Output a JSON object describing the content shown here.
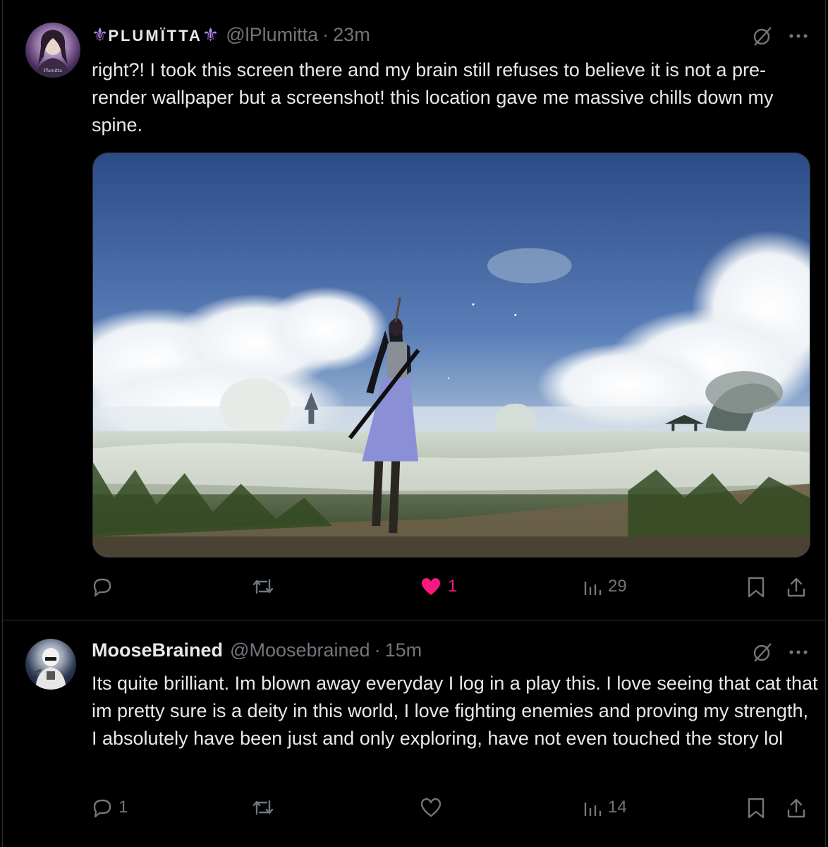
{
  "tweets": [
    {
      "display_name": "PLUMÏTTA",
      "name_decoration": "⚜",
      "handle": "@lPlumitta",
      "separator": "·",
      "time": "23m",
      "text": "right?! I took this screen there and my brain still refuses to believe it is not a pre-render wallpaper but a screenshot! this location gave me massive chills down my spine.",
      "avatar_icon": "profile-avatar",
      "has_media": true,
      "media_description_icon": "game-screenshot-image",
      "actions": {
        "reply_count": "",
        "retweet_count": "",
        "like_count": "1",
        "liked": true,
        "views_count": "29"
      }
    },
    {
      "display_name": "MooseBrained",
      "handle": "@Moosebrained",
      "separator": "·",
      "time": "15m",
      "text": "Its quite brilliant. Im blown away everyday I log in a play this. I love seeing that cat that im pretty sure is a deity in this world, I love fighting enemies and proving my strength, I absolutely have been just and only exploring, have not even touched the story lol",
      "avatar_icon": "profile-avatar",
      "has_media": false,
      "actions": {
        "reply_count": "1",
        "retweet_count": "",
        "like_count": "",
        "liked": false,
        "views_count": "14"
      }
    }
  ],
  "colors": {
    "background": "#000000",
    "text_primary": "#e7e9ea",
    "text_secondary": "#71767b",
    "like_active": "#f91880",
    "border": "#2f3336",
    "name_decoration": "#b48cf0"
  },
  "icons": [
    "reply-icon",
    "retweet-icon",
    "like-icon",
    "views-icon",
    "bookmark-icon",
    "share-icon",
    "grok-icon",
    "more-icon"
  ]
}
